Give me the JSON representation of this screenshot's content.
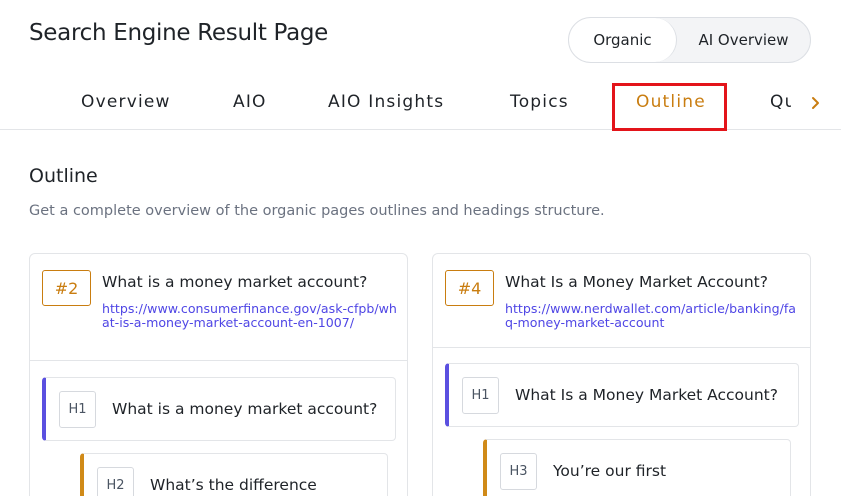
{
  "header": {
    "title": "Search Engine Result Page",
    "toggle": {
      "organic": "Organic",
      "ai_overview": "AI Overview"
    }
  },
  "tabs": {
    "items": [
      "Overview",
      "AIO",
      "AIO Insights",
      "Topics",
      "Outline"
    ],
    "active": "Outline",
    "clipped_label": "Qu",
    "accent_color": "#c97d10",
    "highlight_color": "#e3141a"
  },
  "section": {
    "title": "Outline",
    "description": "Get a complete overview of the organic pages outlines and headings structure."
  },
  "cards": [
    {
      "rank": "#2",
      "title": "What is a money market account?",
      "url": "https://www.consumerfinance.gov/ask-cfpb/what-is-a-money-market-account-en-1007/",
      "headings": [
        {
          "tag": "H1",
          "text": "What is a money market account?"
        },
        {
          "tag": "H2",
          "text": "What’s the difference"
        }
      ]
    },
    {
      "rank": "#4",
      "title": "What Is a Money Market Account?",
      "url": "https://www.nerdwallet.com/article/banking/faq-money-market-account",
      "headings": [
        {
          "tag": "H1",
          "text": "What Is a Money Market Account?"
        },
        {
          "tag": "H3",
          "text": "You’re our first"
        }
      ]
    }
  ]
}
